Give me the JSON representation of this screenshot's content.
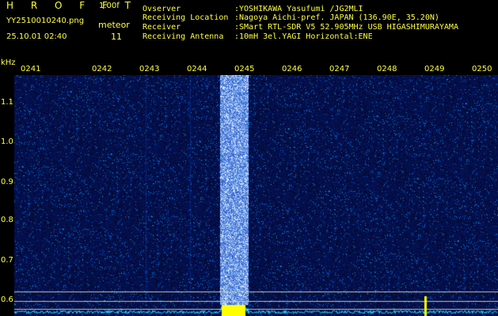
{
  "header": {
    "app_title": "H R O F F T",
    "app_version": "1.00f",
    "file_name": "YY2510010240.png",
    "meteor_label": "meteor",
    "date_time": "25.10.01 02:40",
    "meteor_count": "11"
  },
  "station_info": [
    {
      "label": "Ovserver",
      "value": ":YOSHIKAWA Yasufumi /JG2MLI"
    },
    {
      "label": "Receiving Location",
      "value": ":Nagoya Aichi-pref. JAPAN (136.90E, 35.20N)"
    },
    {
      "label": "Receiver",
      "value": ":SMart RTL-SDR V5 52.905MHz USB HIGASHIMURAYAMA"
    },
    {
      "label": "Receiving Antenna",
      "value": ":10mH 3el.YAGI Horizontal:ENE"
    }
  ],
  "spectrogram": {
    "y_unit": "kHz",
    "x_ticks": [
      "0241",
      "0242",
      "0243",
      "0244",
      "0245",
      "0246",
      "0247",
      "0248",
      "0249",
      "0250"
    ],
    "y_ticks": [
      "1.1",
      "1.0",
      "0.9",
      "0.8",
      "0.7",
      "0.6"
    ],
    "colors": {
      "text_yellow": "#ffff40",
      "text_green": "#a0ff60",
      "noise_floor": "#08105a",
      "band_bright": "#4a7cff",
      "spectrum_line": "#30d8ff",
      "spike": "#ffff00"
    }
  }
}
